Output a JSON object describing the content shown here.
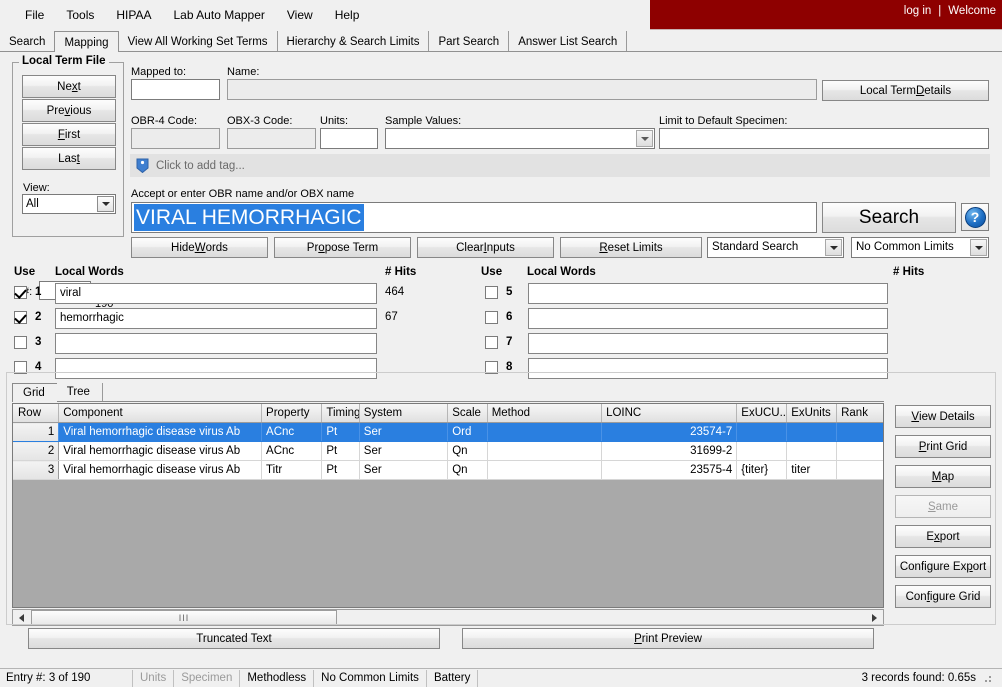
{
  "banner": {
    "login_label": "log in",
    "separator": "|",
    "welcome_label": "Welcome"
  },
  "menubar": {
    "items": [
      {
        "label": "File"
      },
      {
        "label": "Tools"
      },
      {
        "label": "HIPAA"
      },
      {
        "label": "Lab Auto Mapper"
      },
      {
        "label": "View"
      },
      {
        "label": "Help"
      }
    ]
  },
  "tabs": [
    {
      "label": "Search",
      "active": false
    },
    {
      "label": "Mapping",
      "active": true
    },
    {
      "label": "View All Working Set Terms",
      "active": false
    },
    {
      "label": "Hierarchy & Search Limits",
      "active": false
    },
    {
      "label": "Part Search",
      "active": false
    },
    {
      "label": "Answer List Search",
      "active": false
    }
  ],
  "local_term_file": {
    "title": "Local Term File",
    "buttons": [
      {
        "label_pre": "Ne",
        "label_accel": "x",
        "label_post": "t",
        "name": "next"
      },
      {
        "label_pre": "Pre",
        "label_accel": "v",
        "label_post": "ious",
        "name": "previous"
      },
      {
        "label_pre": "",
        "label_accel": "F",
        "label_post": "irst",
        "name": "first"
      },
      {
        "label_pre": "Las",
        "label_accel": "t",
        "label_post": "",
        "name": "last"
      }
    ],
    "view_label": "View:",
    "view_value": "All",
    "num_label": "#:",
    "num_value": "3",
    "num_of": "of 190"
  },
  "fields": {
    "mapped_to_label": "Mapped to:",
    "mapped_to_value": "",
    "name_label": "Name:",
    "name_value": "",
    "obr4_label": "OBR-4 Code:",
    "obr4_value": "",
    "obx3_label": "OBX-3 Code:",
    "obx3_value": "",
    "units_label": "Units:",
    "units_value": "",
    "sample_values_label": "Sample Values:",
    "sample_values_value": "",
    "limit_specimen_label": "Limit to Default Specimen:",
    "limit_specimen_value": "",
    "local_term_details_pre": "Local Term ",
    "local_term_details_accel": "D",
    "local_term_details_post": "etails"
  },
  "tag": {
    "placeholder": "Click to add tag...",
    "icon": "tag-icon"
  },
  "search": {
    "hint": "Accept or enter OBR name and/or OBX name",
    "query": "VIRAL HEMORRHAGIC",
    "button_label": "Search",
    "help_glyph": "?",
    "mode_value": "Standard Search",
    "limits_value": "No Common Limits"
  },
  "action_buttons": [
    {
      "pre": "Hide ",
      "accel": "W",
      "post": "ords",
      "name": "hide-words"
    },
    {
      "pre": "Pr",
      "accel": "o",
      "post": "pose Term",
      "name": "propose-term"
    },
    {
      "pre": "Clear ",
      "accel": "I",
      "post": "nputs",
      "name": "clear-inputs"
    },
    {
      "pre": "",
      "accel": "R",
      "post": "eset Limits",
      "name": "reset-limits"
    }
  ],
  "words_panel": {
    "use_header": "Use",
    "local_words_header": "Local Words",
    "hits_header": "# Hits",
    "left_rows": [
      {
        "num": "1",
        "checked": true,
        "word": "viral",
        "hits": "464"
      },
      {
        "num": "2",
        "checked": true,
        "word": "hemorrhagic",
        "hits": "67"
      },
      {
        "num": "3",
        "checked": false,
        "word": "",
        "hits": ""
      },
      {
        "num": "4",
        "checked": false,
        "word": "",
        "hits": ""
      }
    ],
    "right_rows": [
      {
        "num": "5",
        "checked": false,
        "word": "",
        "hits": ""
      },
      {
        "num": "6",
        "checked": false,
        "word": "",
        "hits": ""
      },
      {
        "num": "7",
        "checked": false,
        "word": "",
        "hits": ""
      },
      {
        "num": "8",
        "checked": false,
        "word": "",
        "hits": ""
      }
    ]
  },
  "grid_tabs": [
    {
      "label": "Grid",
      "active": true
    },
    {
      "label": "Tree",
      "active": false
    }
  ],
  "grid": {
    "columns": [
      "Row",
      "Component",
      "Property",
      "Timing",
      "System",
      "Scale",
      "Method",
      "LOINC",
      "ExUCU...",
      "ExUnits",
      "Rank"
    ],
    "rows": [
      {
        "selected": true,
        "cells": [
          "1",
          "Viral hemorrhagic disease virus Ab",
          "ACnc",
          "Pt",
          "Ser",
          "Ord",
          "",
          "23574-7",
          "",
          "",
          ""
        ]
      },
      {
        "selected": false,
        "cells": [
          "2",
          "Viral hemorrhagic disease virus Ab",
          "ACnc",
          "Pt",
          "Ser",
          "Qn",
          "",
          "31699-2",
          "",
          "",
          ""
        ]
      },
      {
        "selected": false,
        "cells": [
          "3",
          "Viral hemorrhagic disease virus Ab",
          "Titr",
          "Pt",
          "Ser",
          "Qn",
          "",
          "23575-4",
          "{titer}",
          "titer",
          ""
        ]
      }
    ]
  },
  "right_buttons": [
    {
      "pre": "",
      "accel": "V",
      "post": "iew Details",
      "name": "view-details",
      "disabled": false
    },
    {
      "pre": "",
      "accel": "P",
      "post": "rint Grid",
      "name": "print-grid",
      "disabled": false
    },
    {
      "pre": "",
      "accel": "M",
      "post": "ap",
      "name": "map",
      "disabled": false
    },
    {
      "pre": "",
      "accel": "S",
      "post": "ame",
      "name": "same",
      "disabled": true
    },
    {
      "pre": "E",
      "accel": "x",
      "post": "port",
      "name": "export",
      "disabled": false
    },
    {
      "pre": "Configure Ex",
      "accel": "p",
      "post": "ort",
      "name": "configure-export",
      "disabled": false
    },
    {
      "pre": "Con",
      "accel": "f",
      "post": "igure Grid",
      "name": "configure-grid",
      "disabled": false
    }
  ],
  "bottom_buttons": {
    "truncated_text": "Truncated Text",
    "print_preview_pre": "",
    "print_preview_accel": "P",
    "print_preview_post": "rint Preview"
  },
  "statusbar": {
    "entry": "Entry #: 3 of 190",
    "cells": [
      {
        "label": "Units",
        "dim": true
      },
      {
        "label": "Specimen",
        "dim": true
      },
      {
        "label": "Methodless",
        "dim": false
      },
      {
        "label": "No Common Limits",
        "dim": false
      },
      {
        "label": "Battery",
        "dim": false
      }
    ],
    "records": "3 records found: 0.65s"
  },
  "colors": {
    "banner_red": "#8e0000",
    "selection_blue": "#2a7fe0",
    "grid_empty_grey": "#a9a9a9"
  }
}
